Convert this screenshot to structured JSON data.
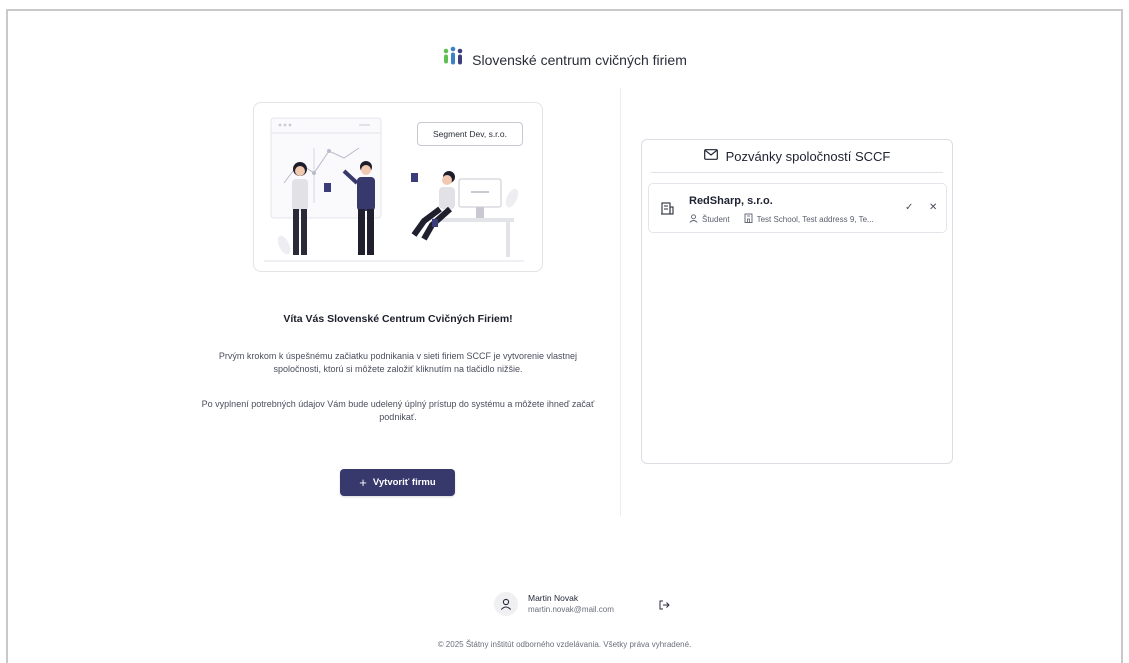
{
  "brand": {
    "name": "Slovenské centrum cvičných firiem",
    "colors": [
      "#5fbf55",
      "#3b82c4",
      "#3d3f7a"
    ]
  },
  "illustration": {
    "badge": "Segment Dev, s.r.o."
  },
  "welcome": {
    "title": "Víta Vás Slovenské Centrum Cvičných Firiem!",
    "paragraph1": "Prvým krokom k úspešnému začiatku podnikania v sieti firiem SCCF je vytvorenie vlastnej spoločnosti, ktorú si môžete založiť kliknutím na tlačidlo nižšie.",
    "paragraph2": "Po vyplnení potrebných údajov Vám bude udelený úplný prístup do systému a môžete ihneď začať podnikať.",
    "create_button": "Vytvoriť firmu",
    "create_button_icon": "+"
  },
  "invitations": {
    "title": "Pozvánky spoločností SCCF",
    "items": [
      {
        "company": "RedSharp, s.r.o.",
        "role": "Študent",
        "address": "Test School, Test address 9, Te..."
      }
    ]
  },
  "user": {
    "name": "Martin Novak",
    "email": "martin.novak@mail.com"
  },
  "footer": {
    "copyright": "© 2025 Štátny inštitút odborného vzdelávania. Všetky práva vyhradené."
  },
  "accent": "#37386b"
}
